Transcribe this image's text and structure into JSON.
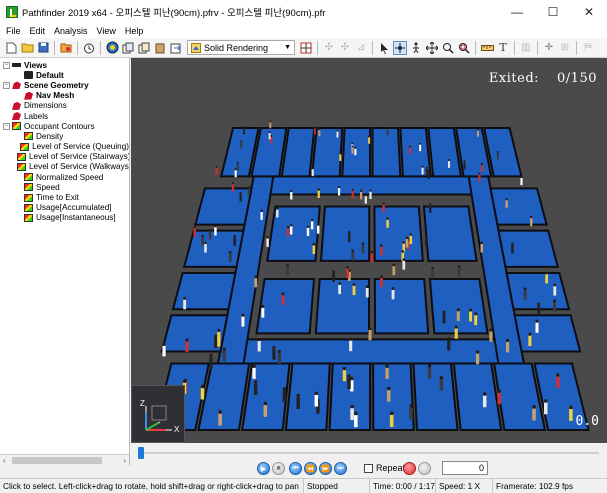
{
  "window": {
    "title": "Pathfinder 2019 x64 - 오피스텔 피난(90cm).pfrv - 오피스텔 피난(90cm).pfr",
    "minimize": "—",
    "maximize": "☐",
    "close": "✕"
  },
  "menu": [
    "File",
    "Edit",
    "Analysis",
    "View",
    "Help"
  ],
  "toolbar": {
    "render_mode": "Solid Rendering"
  },
  "tree": [
    {
      "label": "Views",
      "bold": true,
      "depth": 0,
      "icon": "views-icon",
      "expanded": true
    },
    {
      "label": "Default",
      "bold": true,
      "depth": 1,
      "icon": "camera-icon"
    },
    {
      "label": "Scene Geometry",
      "bold": true,
      "depth": 0,
      "icon": "geometry-icon",
      "expanded": true
    },
    {
      "label": "Nav Mesh",
      "bold": true,
      "depth": 1,
      "icon": "navmesh-icon"
    },
    {
      "label": "Dimensions",
      "bold": false,
      "depth": 0,
      "icon": "geometry-icon"
    },
    {
      "label": "Labels",
      "bold": false,
      "depth": 0,
      "icon": "geometry-icon"
    },
    {
      "label": "Occupant Contours",
      "bold": false,
      "depth": 0,
      "icon": "contour-icon",
      "expanded": true
    },
    {
      "label": "Density",
      "bold": false,
      "depth": 1,
      "icon": "contour-icon"
    },
    {
      "label": "Level of Service (Queuing)",
      "bold": false,
      "depth": 1,
      "icon": "contour-icon"
    },
    {
      "label": "Level of Service (Stairways)",
      "bold": false,
      "depth": 1,
      "icon": "contour-icon"
    },
    {
      "label": "Level of Service (Walkways)",
      "bold": false,
      "depth": 1,
      "icon": "contour-icon"
    },
    {
      "label": "Normalized Speed",
      "bold": false,
      "depth": 1,
      "icon": "contour-icon"
    },
    {
      "label": "Speed",
      "bold": false,
      "depth": 1,
      "icon": "contour-icon"
    },
    {
      "label": "Time to Exit",
      "bold": false,
      "depth": 1,
      "icon": "contour-icon"
    },
    {
      "label": "Usage[Accumulated]",
      "bold": false,
      "depth": 1,
      "icon": "contour-icon"
    },
    {
      "label": "Usage[Instantaneous]",
      "bold": false,
      "depth": 1,
      "icon": "contour-icon"
    }
  ],
  "viewport": {
    "exited_label": "Exited:",
    "exited_count": "0/150",
    "time_display": "0.0",
    "axis_z": "Z",
    "axis_x": "X",
    "floor_color": "#1f5fbf",
    "wall_color": "#0d0d14",
    "background_color": "#4a4a4a"
  },
  "playback": {
    "repeat_label": "Repeat",
    "frame_value": "0",
    "progress": 0
  },
  "status": {
    "hint": "Click to select. Left-click+drag to rotate, hold shift+drag or right-click+drag to pan",
    "state": "Stopped",
    "time": "Time: 0:00 / 1:17",
    "speed": "Speed: 1 X",
    "framerate": "Framerate: 102.9 fps"
  }
}
